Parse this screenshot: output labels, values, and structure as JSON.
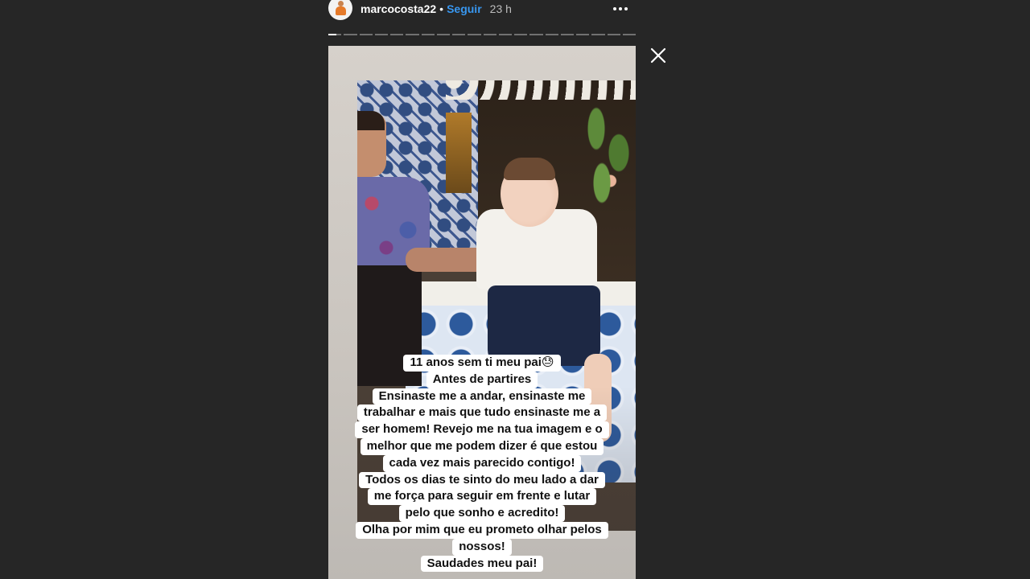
{
  "header": {
    "username": "marcocosta22",
    "separator": "•",
    "follow_label": "Seguir",
    "time": "23 h",
    "more_icon": "more-horizontal-icon"
  },
  "progress": {
    "segments": 20,
    "active_segment": 1,
    "active_fill": 0.6
  },
  "close_icon": "close-icon",
  "story": {
    "caption_lines": [
      "11 anos sem ti meu pai😓",
      "Antes de partires",
      "Ensinaste me a andar, ensinaste me",
      "trabalhar e mais que tudo ensinaste me a",
      "ser homem! Revejo me na tua imagem e o",
      "melhor que me podem dizer é que estou",
      "cada vez mais parecido contigo!",
      "Todos os dias te sinto do meu lado a dar",
      "me força para seguir em frente e lutar",
      "pelo que sonho e acredito!",
      "Olha por mim que eu prometo olhar pelos",
      "nossos!",
      "Saudades meu pai!"
    ]
  },
  "colors": {
    "background": "#262626",
    "follow": "#3897f0",
    "caption_bg": "#ffffff"
  }
}
